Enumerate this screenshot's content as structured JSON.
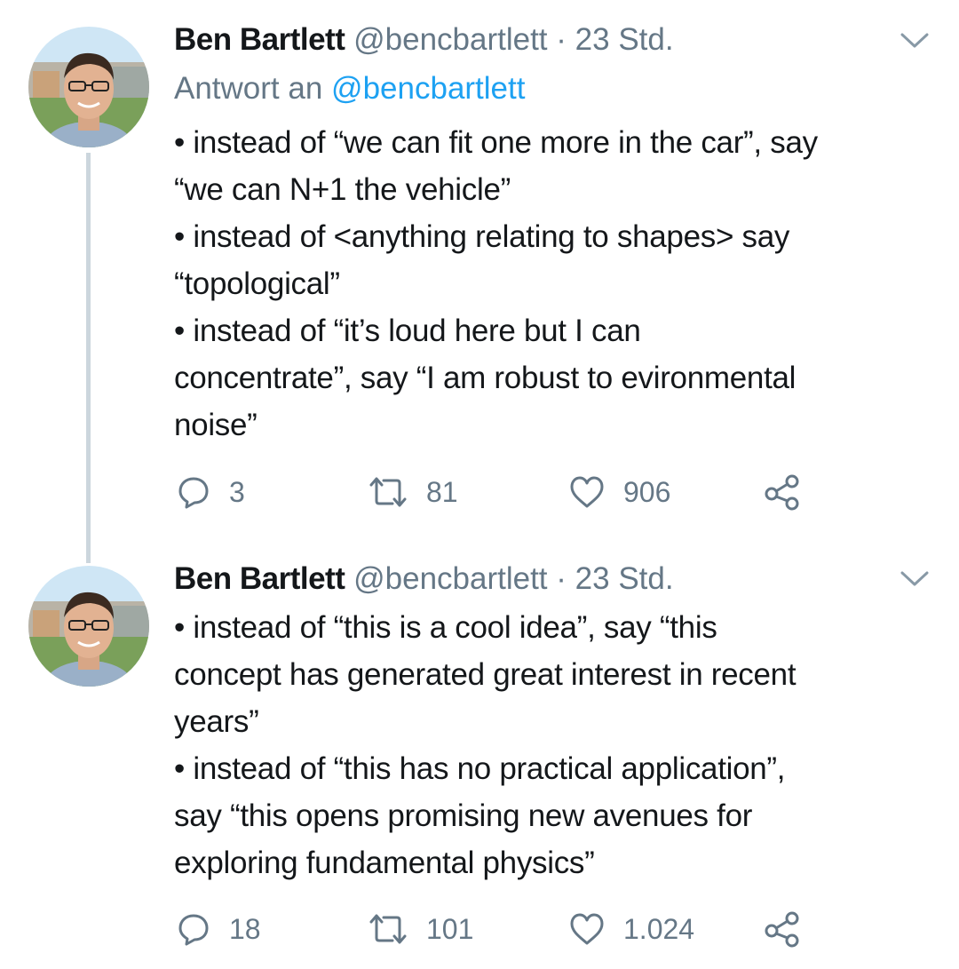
{
  "tweets": [
    {
      "name": "Ben Bartlett",
      "handle": "@bencbartlett",
      "separator": "·",
      "time": "23 Std.",
      "reply_prefix": "Antwort an",
      "reply_mention": "@bencbartlett",
      "lines": [
        "• instead of “we can fit one more in the car”, say",
        "“we can N+1 the vehicle”",
        "• instead of <anything relating to shapes> say",
        "“topological”",
        "• instead of “it’s loud here but I can",
        "concentrate”, say “I am robust to evironmental",
        "noise”"
      ],
      "replies": "3",
      "retweets": "81",
      "likes": "906"
    },
    {
      "name": "Ben Bartlett",
      "handle": "@bencbartlett",
      "separator": "·",
      "time": "23 Std.",
      "lines": [
        "• instead of “this is a cool idea”, say “this",
        "concept has generated great interest in recent",
        "years”",
        "• instead of “this has no practical application”,",
        "say “this opens promising new avenues for",
        "exploring fundamental physics”"
      ],
      "replies": "18",
      "retweets": "101",
      "likes": "1.024"
    }
  ],
  "icons": {
    "reply": "reply-icon",
    "retweet": "retweet-icon",
    "like": "heart-icon",
    "share": "share-icon",
    "menu": "chevron-down-icon"
  },
  "colors": {
    "text": "#14171a",
    "muted": "#657786",
    "link": "#1da1f2",
    "thread_line": "#ccd6dd"
  }
}
